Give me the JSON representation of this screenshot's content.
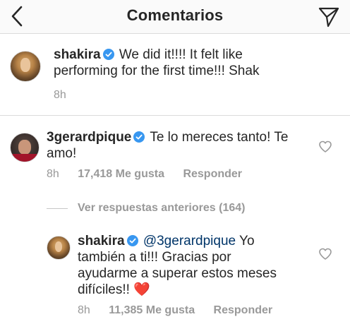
{
  "header": {
    "title": "Comentarios"
  },
  "caption": {
    "username": "shakira",
    "text": "We did it!!!! It felt like",
    "text_line2": "performing for the first time!!! Shak",
    "time": "8h"
  },
  "comment": {
    "username": "3gerardpique",
    "text": "Te lo mereces tanto! Te",
    "text_line2": "amo!",
    "time": "8h",
    "likes": "17,418 Me gusta",
    "reply_label": "Responder"
  },
  "view_replies": {
    "label": "Ver respuestas anteriores (164)"
  },
  "reply": {
    "username": "shakira",
    "mention": "@3gerardpique",
    "text_after_mention": "Yo",
    "text_line2": "también a ti!!! Gracias por",
    "text_line3": "ayudarme a superar estos meses",
    "text_line4": "difíciles!!",
    "emoji": "❤️",
    "time": "8h",
    "likes": "11,385 Me gusta",
    "reply_label": "Responder"
  },
  "colors": {
    "verified": "#3897f0",
    "mention": "#003569",
    "meta": "#999999",
    "heart_emoji": "#ed1c3a"
  }
}
